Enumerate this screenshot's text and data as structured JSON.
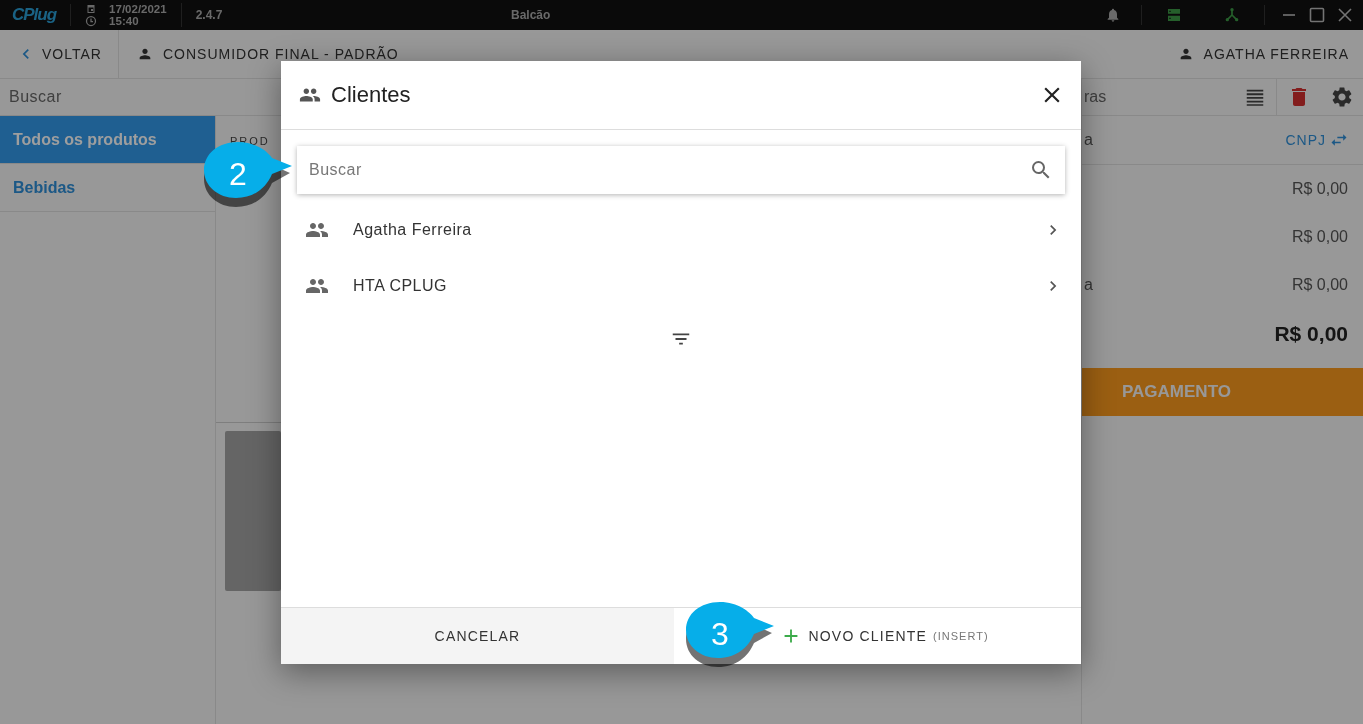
{
  "title_bar": {
    "logo": "CPlug",
    "date": "17/02/2021",
    "time": "15:40",
    "version": "2.4.7",
    "title": "Balcão"
  },
  "header": {
    "back": "VOLTAR",
    "customer": "CONSUMIDOR FINAL - PADRÃO",
    "user": "AGATHA FERREIRA"
  },
  "search": {
    "placeholder": "Buscar"
  },
  "categories": [
    {
      "label": "Todos os produtos",
      "selected": true
    },
    {
      "label": "Bebidas",
      "selected": false
    }
  ],
  "products": {
    "column_1": "PROD"
  },
  "order": {
    "search": {
      "placeholder": "ras"
    },
    "column_1": "a",
    "cnpj": "CNPJ",
    "rows": [
      {
        "value": "R$ 0,00"
      },
      {
        "value": "R$ 0,00"
      },
      {
        "label": "a",
        "value": "R$ 0,00"
      }
    ],
    "total": "R$ 0,00",
    "payment": "PAGAMENTO"
  },
  "dialog": {
    "title": "Clientes",
    "search": {
      "placeholder": "Buscar"
    },
    "clients": [
      {
        "name": "Agatha Ferreira"
      },
      {
        "name": "HTA CPLUG"
      }
    ],
    "cancel": "CANCELAR",
    "new_client": "NOVO CLIENTE",
    "new_client_shortcut": "(INSERT)"
  },
  "callouts": [
    {
      "number": "2"
    },
    {
      "number": "3"
    }
  ]
}
